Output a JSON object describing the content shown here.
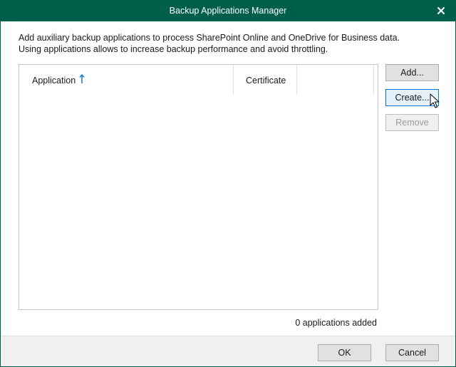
{
  "window": {
    "title": "Backup Applications Manager"
  },
  "description": "Add auxiliary backup applications to process SharePoint Online and OneDrive for Business data. Using applications allows to increase backup performance and avoid throttling.",
  "table": {
    "columns": [
      {
        "label": "Application",
        "sort": "ascending"
      },
      {
        "label": "Certificate"
      },
      {
        "label": ""
      }
    ],
    "rows": []
  },
  "buttons": {
    "add": "Add...",
    "create": "Create...",
    "remove": "Remove",
    "ok": "OK",
    "cancel": "Cancel"
  },
  "status": {
    "count_text": "0 applications added"
  },
  "colors": {
    "titlebar": "#005f4b",
    "sort_arrow": "#1a7fc1",
    "focused_button_border": "#0078d7"
  },
  "icons": {
    "close": "close-icon",
    "sort": "sort-ascending-arrow-icon",
    "cursor": "mouse-pointer-icon"
  }
}
